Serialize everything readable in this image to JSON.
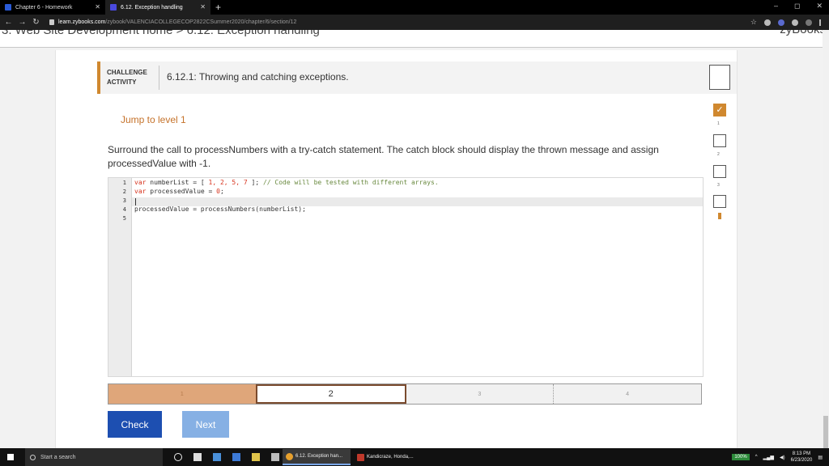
{
  "browser": {
    "tabs": [
      {
        "title": "Chapter 6 - Homework",
        "active": false
      },
      {
        "title": "6.12. Exception handling",
        "active": true
      }
    ],
    "new_tab": "+",
    "url_host": "learn.zybooks.com",
    "url_path": "/zybook/VALENCIACOLLEGECOP2822CSummer2020/chapter/6/section/12",
    "window_controls": [
      "–",
      "◻",
      "✕"
    ]
  },
  "page_header": {
    "breadcrumb": "3. Web Site Development home > 6.12: Exception handling",
    "brand": "zyBooks"
  },
  "activity": {
    "label_line1": "CHALLENGE",
    "label_line2": "ACTIVITY",
    "title": "6.12.1: Throwing and catching exceptions.",
    "jump": "Jump to level 1",
    "instructions": "Surround the call to processNumbers with a try-catch statement. The catch block should display the thrown message and assign processedValue with -1."
  },
  "code": {
    "line_numbers": [
      "1",
      "2",
      "3",
      "4",
      "5"
    ],
    "line1_kw": "var",
    "line1_a": " numberList = [ ",
    "line1_nums": "1, 2, 5, 7",
    "line1_b": " ]; ",
    "line1_comment": "// Code will be tested with different arrays.",
    "line2_kw": "var",
    "line2_a": " processedValue = ",
    "line2_num": "0",
    "line2_b": ";",
    "line4": "processedValue = processNumbers(numberList);"
  },
  "levels": {
    "items": [
      "1",
      "2",
      "3",
      "4"
    ],
    "completed": 1,
    "current": 2
  },
  "buttons": {
    "check": "Check",
    "next": "Next"
  },
  "side_levels": {
    "check_mark": "✓",
    "numbers": [
      "1",
      "2",
      "3"
    ]
  },
  "taskbar": {
    "search_placeholder": "Start a search",
    "apps": [
      {
        "label": "6.12. Exception han...",
        "color": "#e7a02d"
      },
      {
        "label": "Kandicraze, Honda,...",
        "color": "#c0392b"
      }
    ],
    "battery": "100%",
    "time": "8:13 PM",
    "date": "6/23/2020"
  },
  "colors": {
    "accent": "#d0882f",
    "check_button": "#1d4fb1",
    "next_button": "#86b0e4"
  }
}
